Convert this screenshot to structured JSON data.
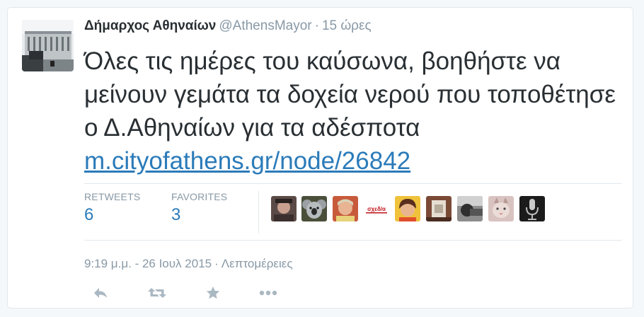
{
  "tweet": {
    "author_name": "Δήμαρχος Αθηναίων",
    "handle": "@AthensMayor",
    "separator": "·",
    "relative_time": "15 ώρες",
    "text": "Όλες τις ημέρες του καύσωνα, βοηθήστε να μείνουν γεμάτα τα δοχεία νερού που τοποθέτησε ο Δ.Αθηναίων για τα αδέσποτα",
    "link_text": "m.cityofathens.gr/node/26842",
    "stats": {
      "retweets_label": "RETWEETS",
      "retweets_value": "6",
      "favorites_label": "FAVORITES",
      "favorites_value": "3"
    },
    "favoriter_avatars": [
      "favoriter-avatar-1",
      "favoriter-avatar-koala",
      "favoriter-avatar-3",
      "favoriter-avatar-sxedia",
      "favoriter-avatar-5",
      "favoriter-avatar-6",
      "favoriter-avatar-7",
      "favoriter-avatar-cat",
      "favoriter-avatar-microphone"
    ],
    "sxedia_logo_text": "σχεδ/α",
    "timestamp": "9:19 μ.μ. - 26 Ιουλ 2015",
    "timestamp_separator": "·",
    "details_label": "Λεπτομέρειες",
    "actions": [
      "reply-icon",
      "retweet-icon",
      "favorite-icon",
      "more-icon"
    ]
  },
  "colors": {
    "link": "#2b7bb9",
    "muted": "#8899a6",
    "text": "#292f33",
    "border": "#e1e8ed",
    "background": "#f5f8fa"
  }
}
